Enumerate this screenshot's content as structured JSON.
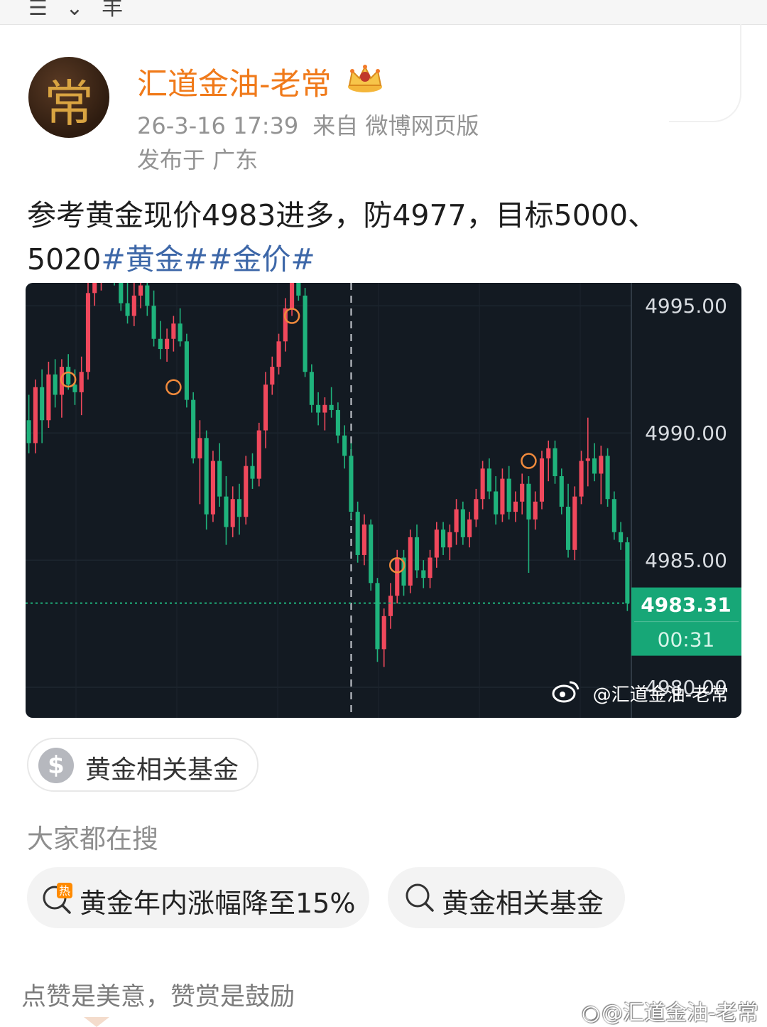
{
  "author": {
    "name": "汇道金油-老常",
    "avatar_char": "常",
    "badge_icon": "crown-icon"
  },
  "post": {
    "time": "26-3-16 17:39",
    "source": "来自 微博网页版",
    "location": "发布于 广东",
    "text_main": "参考黄金现价4983进多，防4977，目标5000、5020",
    "tag1": "#黄金#",
    "tag2": "#金价#"
  },
  "chart": {
    "price_label": "4983.31",
    "countdown": "00:31",
    "watermark": "@汇道金油-老常"
  },
  "chart_data": {
    "type": "candlestick",
    "y_ticks": [
      "4995.00",
      "4990.00",
      "4985.00",
      "4980.00"
    ],
    "ylim": [
      4978.8,
      4995.9
    ],
    "current_price": 4983.31,
    "up_color": "#f0485c",
    "down_color": "#1fb37c",
    "candles": [
      [
        4990.5,
        4991.5,
        4989.2,
        4989.6
      ],
      [
        4989.6,
        4992.1,
        4989.2,
        4991.8
      ],
      [
        4991.8,
        4992.5,
        4989.6,
        4990.5
      ],
      [
        4990.5,
        4992.8,
        4990.2,
        4992.3
      ],
      [
        4992.3,
        4992.9,
        4991.0,
        4991.5
      ],
      [
        4991.5,
        4992.9,
        4990.6,
        4992.6
      ],
      [
        4992.6,
        4993.1,
        4991.7,
        4991.9
      ],
      [
        4991.9,
        4992.5,
        4991.1,
        4991.6
      ],
      [
        4991.6,
        4993.0,
        4990.7,
        4992.4
      ],
      [
        4992.4,
        4995.9,
        4992.1,
        4995.5
      ],
      [
        4995.5,
        4997.0,
        4995.0,
        4996.4
      ],
      [
        4996.4,
        4997.2,
        4995.6,
        4996.9
      ],
      [
        4996.9,
        4997.5,
        4996.2,
        4996.6
      ],
      [
        4996.6,
        4997.3,
        4995.8,
        4996.2
      ],
      [
        4996.2,
        4996.9,
        4994.8,
        4995.1
      ],
      [
        4995.1,
        4995.9,
        4994.3,
        4994.6
      ],
      [
        4994.6,
        4996.0,
        4994.2,
        4995.4
      ],
      [
        4995.4,
        4996.1,
        4994.9,
        4995.8
      ],
      [
        4995.8,
        4996.0,
        4994.6,
        4995.0
      ],
      [
        4995.0,
        4995.6,
        4993.4,
        4993.7
      ],
      [
        4993.7,
        4994.4,
        4992.9,
        4993.3
      ],
      [
        4993.3,
        4994.1,
        4992.8,
        4993.7
      ],
      [
        4993.7,
        4994.6,
        4993.2,
        4994.3
      ],
      [
        4994.3,
        4994.9,
        4993.4,
        4993.6
      ],
      [
        4993.6,
        4993.9,
        4991.0,
        4991.3
      ],
      [
        4991.3,
        4991.6,
        4988.8,
        4989.0
      ],
      [
        4989.0,
        4990.5,
        4987.2,
        4989.8
      ],
      [
        4989.8,
        4990.1,
        4986.2,
        4986.8
      ],
      [
        4986.8,
        4989.3,
        4986.5,
        4988.9
      ],
      [
        4988.9,
        4989.6,
        4987.1,
        4987.5
      ],
      [
        4987.5,
        4988.3,
        4985.6,
        4986.3
      ],
      [
        4986.3,
        4987.9,
        4985.9,
        4987.4
      ],
      [
        4987.4,
        4988.0,
        4986.0,
        4986.7
      ],
      [
        4986.7,
        4989.1,
        4986.4,
        4988.7
      ],
      [
        4988.7,
        4989.2,
        4987.8,
        4988.2
      ],
      [
        4988.2,
        4990.4,
        4987.9,
        4990.1
      ],
      [
        4990.1,
        4992.4,
        4989.4,
        4991.9
      ],
      [
        4991.9,
        4993.0,
        4991.5,
        4992.6
      ],
      [
        4992.6,
        4993.9,
        4992.3,
        4993.6
      ],
      [
        4993.6,
        4995.3,
        4993.2,
        4994.9
      ],
      [
        4994.9,
        4996.3,
        4994.6,
        4995.9
      ],
      [
        4995.9,
        4996.4,
        4995.2,
        4995.4
      ],
      [
        4995.4,
        4995.7,
        4992.2,
        4992.4
      ],
      [
        4992.4,
        4992.7,
        4990.8,
        4991.1
      ],
      [
        4991.1,
        4991.6,
        4990.3,
        4990.8
      ],
      [
        4990.8,
        4991.4,
        4990.1,
        4991.1
      ],
      [
        4991.1,
        4991.8,
        4990.6,
        4990.9
      ],
      [
        4990.9,
        4991.2,
        4989.6,
        4989.9
      ],
      [
        4989.9,
        4990.3,
        4988.6,
        4989.1
      ],
      [
        4989.1,
        4989.6,
        4986.6,
        4986.9
      ],
      [
        4986.9,
        4987.3,
        4984.9,
        4985.2
      ],
      [
        4985.2,
        4986.8,
        4984.8,
        4986.4
      ],
      [
        4986.4,
        4986.6,
        4983.8,
        4984.1
      ],
      [
        4984.1,
        4984.3,
        4981.0,
        4981.5
      ],
      [
        4981.5,
        4983.1,
        4980.8,
        4982.8
      ],
      [
        4982.8,
        4984.1,
        4982.3,
        4983.6
      ],
      [
        4983.6,
        4985.4,
        4983.3,
        4985.1
      ],
      [
        4985.1,
        4985.4,
        4983.6,
        4984.0
      ],
      [
        4984.0,
        4986.2,
        4983.7,
        4985.9
      ],
      [
        4985.9,
        4986.4,
        4984.3,
        4984.6
      ],
      [
        4984.6,
        4985.0,
        4983.9,
        4984.3
      ],
      [
        4984.3,
        4985.4,
        4983.9,
        4985.1
      ],
      [
        4985.1,
        4986.5,
        4984.7,
        4986.2
      ],
      [
        4986.2,
        4986.5,
        4985.2,
        4985.5
      ],
      [
        4985.5,
        4986.4,
        4985.0,
        4986.1
      ],
      [
        4986.1,
        4987.4,
        4985.6,
        4987.0
      ],
      [
        4987.0,
        4987.3,
        4985.6,
        4985.9
      ],
      [
        4985.9,
        4986.9,
        4985.5,
        4986.6
      ],
      [
        4986.6,
        4987.8,
        4986.3,
        4987.4
      ],
      [
        4987.4,
        4988.9,
        4987.0,
        4988.6
      ],
      [
        4988.6,
        4989.0,
        4987.4,
        4987.7
      ],
      [
        4987.7,
        4988.3,
        4986.4,
        4986.8
      ],
      [
        4986.8,
        4988.6,
        4986.5,
        4988.2
      ],
      [
        4988.2,
        4988.7,
        4986.6,
        4986.9
      ],
      [
        4986.9,
        4987.7,
        4986.5,
        4987.3
      ],
      [
        4987.3,
        4988.4,
        4986.8,
        4988.0
      ],
      [
        4988.0,
        4988.3,
        4984.5,
        4986.6
      ],
      [
        4986.6,
        4987.7,
        4986.2,
        4987.3
      ],
      [
        4987.3,
        4989.3,
        4987.0,
        4989.0
      ],
      [
        4989.0,
        4989.7,
        4988.1,
        4989.4
      ],
      [
        4989.4,
        4989.7,
        4988.0,
        4988.3
      ],
      [
        4988.3,
        4988.6,
        4986.8,
        4987.1
      ],
      [
        4987.1,
        4988.0,
        4985.1,
        4985.4
      ],
      [
        4985.4,
        4987.9,
        4985.0,
        4987.5
      ],
      [
        4987.5,
        4989.3,
        4987.2,
        4988.9
      ],
      [
        4988.9,
        4990.6,
        4987.9,
        4989.0
      ],
      [
        4989.0,
        4989.6,
        4988.1,
        4988.4
      ],
      [
        4988.4,
        4989.5,
        4987.2,
        4989.1
      ],
      [
        4989.1,
        4989.4,
        4987.1,
        4987.4
      ],
      [
        4987.4,
        4987.7,
        4985.8,
        4986.1
      ],
      [
        4986.1,
        4986.5,
        4985.4,
        4985.7
      ],
      [
        4985.7,
        4985.9,
        4983.0,
        4983.3
      ]
    ],
    "markers": [
      {
        "index": 6,
        "price": 4992.1
      },
      {
        "index": 22,
        "price": 4991.8
      },
      {
        "index": 40,
        "price": 4994.6
      },
      {
        "index": 56,
        "price": 4984.8
      },
      {
        "index": 76,
        "price": 4988.9
      }
    ],
    "vline_index": 49
  },
  "chips": {
    "fund_label": "黄金相关基金",
    "search_heading": "大家都在搜",
    "search1": "黄金年内涨幅降至15%",
    "search2": "黄金相关基金"
  },
  "footer": {
    "text": "点赞是美意，赞赏是鼓励",
    "watermark": "@汇道金油-老常"
  }
}
